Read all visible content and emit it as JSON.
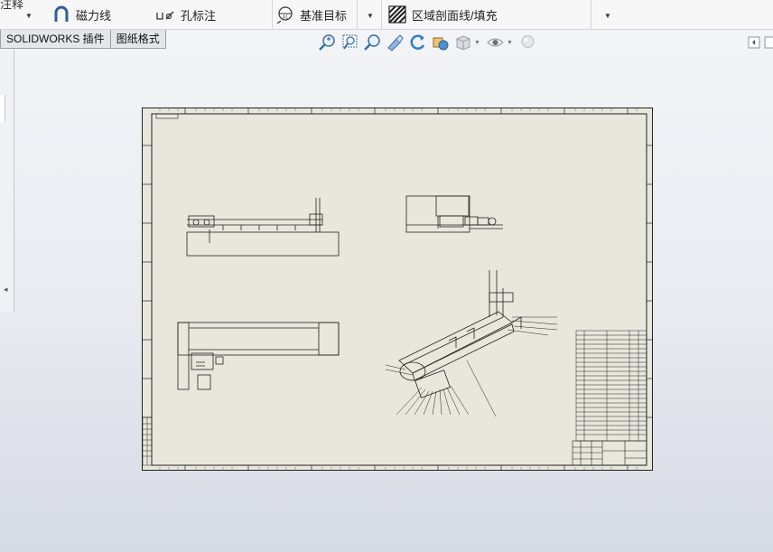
{
  "ribbon": {
    "top_cut_label": "注释",
    "magnetic_line_label": "磁力线",
    "hole_callout_label": "孔标注",
    "datum_target_label": "基准目标",
    "area_hatch_label": "区域剖面线/填充"
  },
  "tabs": [
    {
      "label": "SOLIDWORKS 插件"
    },
    {
      "label": "图纸格式"
    }
  ],
  "hud_icons": [
    "zoom-to-fit-icon",
    "zoom-to-area-icon",
    "previous-view-icon",
    "section-view-icon",
    "rotate-icon",
    "view-orientation-icon",
    "display-style-icon",
    "hide-show-icon",
    "appearance-icon"
  ],
  "colors": {
    "sheet": "#e8e7dc",
    "line": "#1a1a1a",
    "accent": "#2d6fb3"
  }
}
